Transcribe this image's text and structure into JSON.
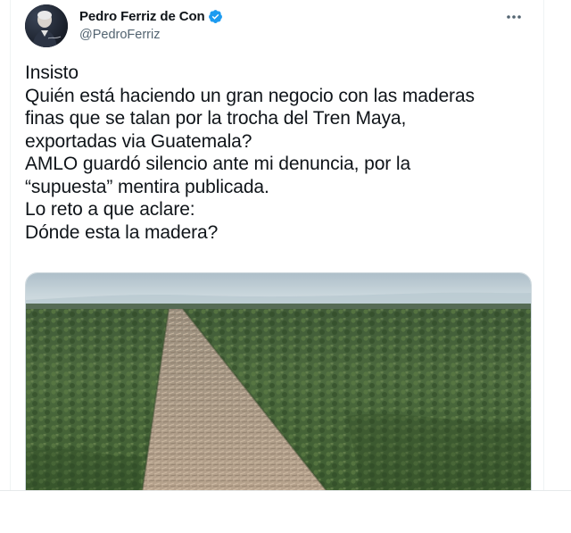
{
  "author": {
    "display_name": "Pedro Ferriz de Con",
    "handle": "@PedroFerriz",
    "verified": true,
    "avatar_icon": "profile-photo"
  },
  "tweet": {
    "lines": [
      "Insisto",
      "Quién está haciendo un gran negocio con las maderas",
      "finas que se talan por la trocha del Tren Maya,",
      "exportadas via Guatemala?",
      "AMLO guardó silencio ante mi denuncia, por la",
      "“supuesta” mentira publicada.",
      "Lo reto a que aclare:",
      "Dónde esta la madera?"
    ]
  },
  "media": {
    "kind": "photo"
  },
  "colors": {
    "text": "#0f1419",
    "secondary": "#536471",
    "verified_blue": "#1d9bf0",
    "border": "#cfd9de"
  },
  "icons": {
    "more": "more-dots-icon",
    "verified": "verified-badge-icon"
  }
}
